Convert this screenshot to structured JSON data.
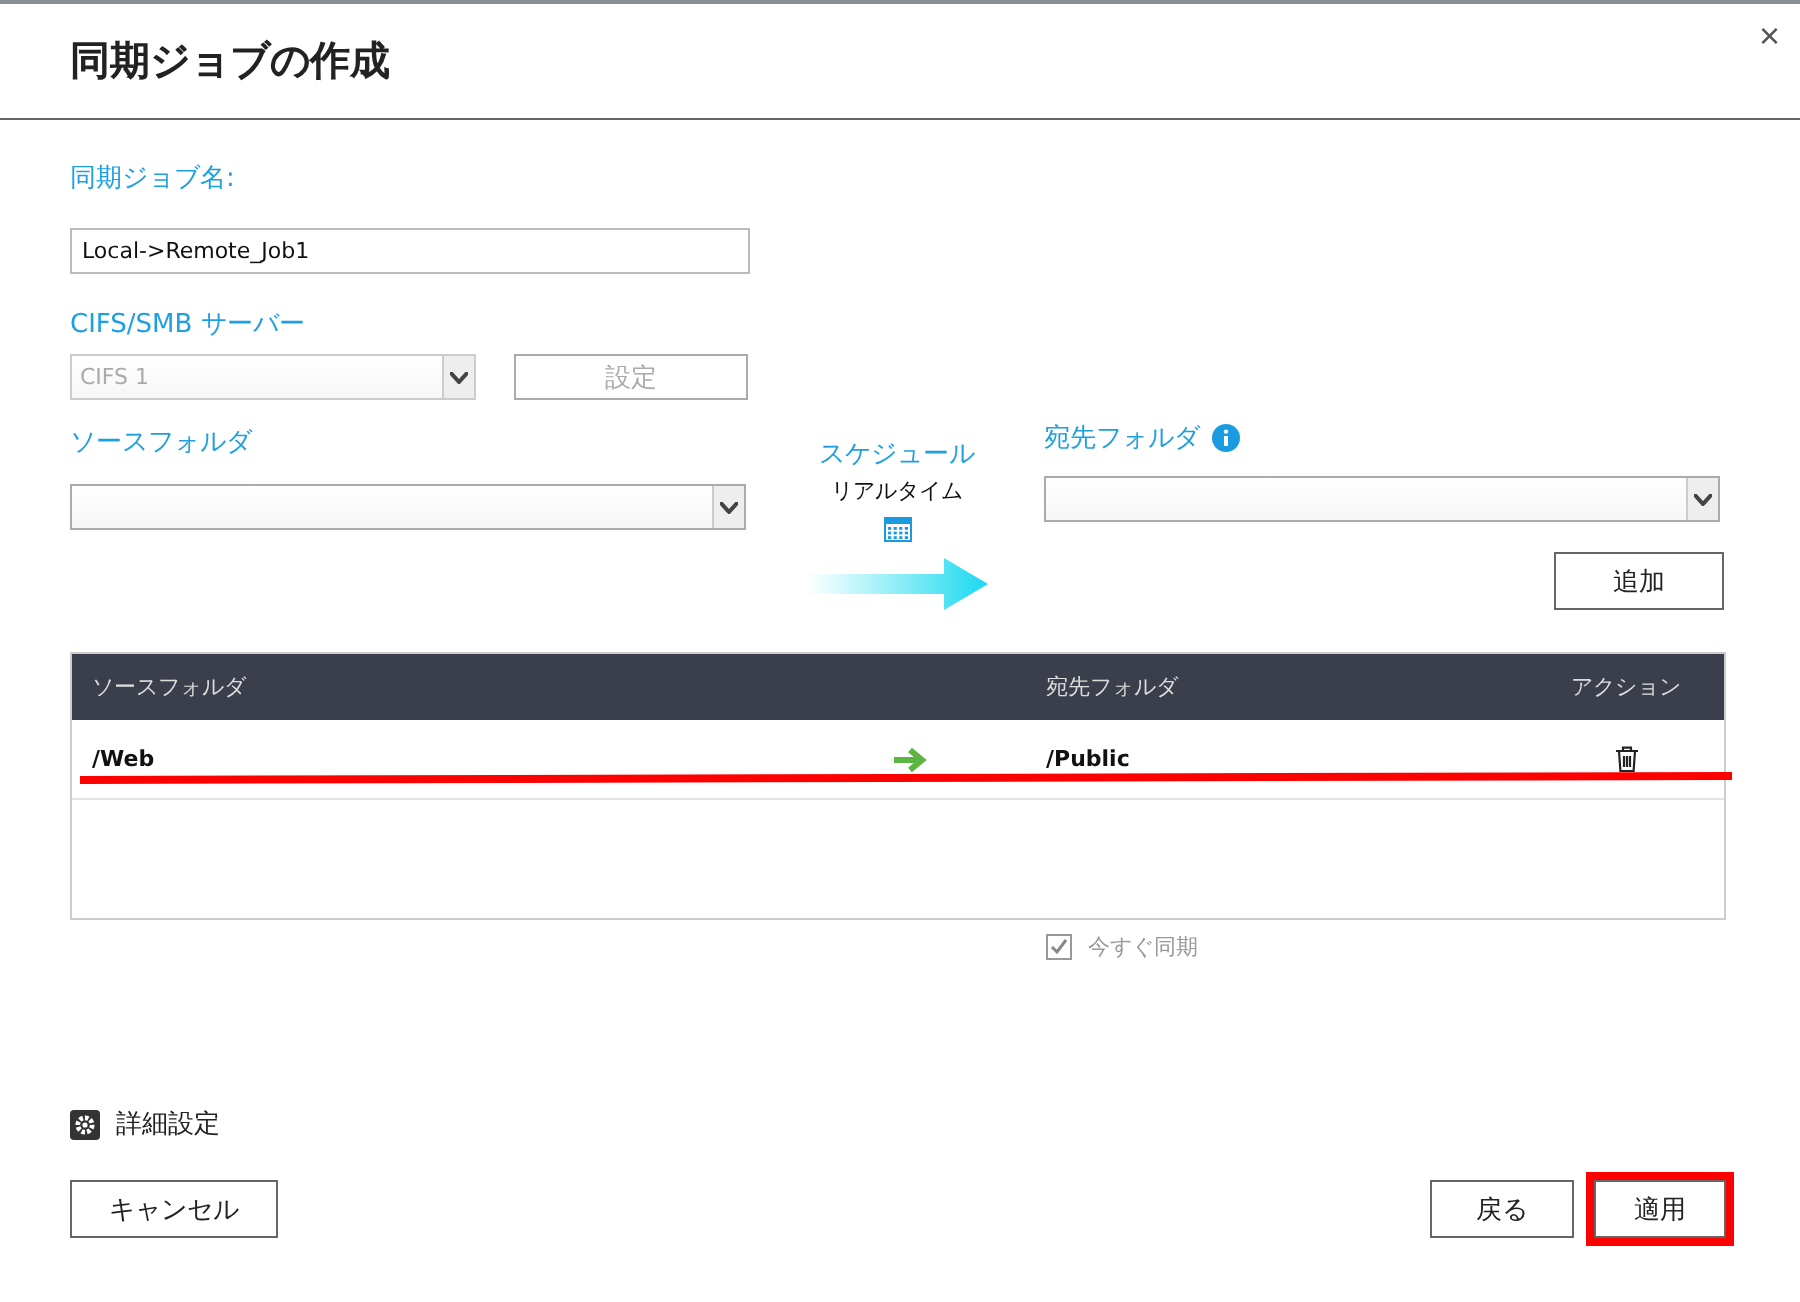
{
  "window": {
    "title": "同期ジョブの作成",
    "close": "×"
  },
  "job_name": {
    "label": "同期ジョブ名:",
    "value": "Local->Remote_Job1"
  },
  "server": {
    "label": "CIFS/SMB サーバー",
    "value": "CIFS 1",
    "disabled": true,
    "settings_button": {
      "label": "設定",
      "disabled": true
    }
  },
  "source": {
    "label": "ソースフォルダ"
  },
  "schedule": {
    "label": "スケジュール",
    "value": "リアルタイム"
  },
  "destination": {
    "label": "宛先フォルダ",
    "add_button": "追加"
  },
  "table": {
    "columns": [
      "ソースフォルダ",
      "宛先フォルダ",
      "アクション"
    ],
    "rows": [
      {
        "source": "/Web",
        "destination": "/Public",
        "highlighted": true
      }
    ]
  },
  "sync_now": {
    "label": "今すぐ同期",
    "checked": true,
    "disabled": true
  },
  "advanced": {
    "label": "詳細設定"
  },
  "buttons": [
    {
      "kind": "cancel",
      "label": "キャンセル",
      "highlighted": false
    },
    {
      "kind": "back",
      "label": "戻る",
      "highlighted": false
    },
    {
      "kind": "apply",
      "label": "適用",
      "highlighted": true
    }
  ]
}
